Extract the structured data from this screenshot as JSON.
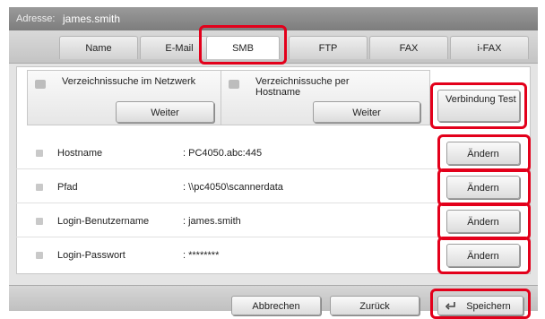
{
  "address": {
    "label": "Adresse:",
    "value": "james.smith"
  },
  "tabs": [
    {
      "label": "Name"
    },
    {
      "label": "E-Mail"
    },
    {
      "label": "SMB"
    },
    {
      "label": "FTP"
    },
    {
      "label": "FAX"
    },
    {
      "label": "i-FAX"
    }
  ],
  "search": {
    "network_label": "Verzeichnissuche im Netzwerk",
    "host_label": "Verzeichnissuche per Hostname",
    "next_label": "Weiter",
    "test_label": "Verbindung Test"
  },
  "fields": [
    {
      "name": "Hostname",
      "value": ": PC4050.abc:445",
      "button": "Ändern"
    },
    {
      "name": "Pfad",
      "value": ": \\\\pc4050\\scannerdata",
      "button": "Ändern"
    },
    {
      "name": "Login-Benutzername",
      "value": ": james.smith",
      "button": "Ändern"
    },
    {
      "name": "Login-Passwort",
      "value": ": ********",
      "button": "Ändern"
    }
  ],
  "footer": {
    "cancel": "Abbrechen",
    "back": "Zurück",
    "save": "Speichern"
  },
  "colors": {
    "highlight": "#e3001b",
    "titlebar": "#8c8c8c",
    "frame": "#e4e4e4"
  }
}
